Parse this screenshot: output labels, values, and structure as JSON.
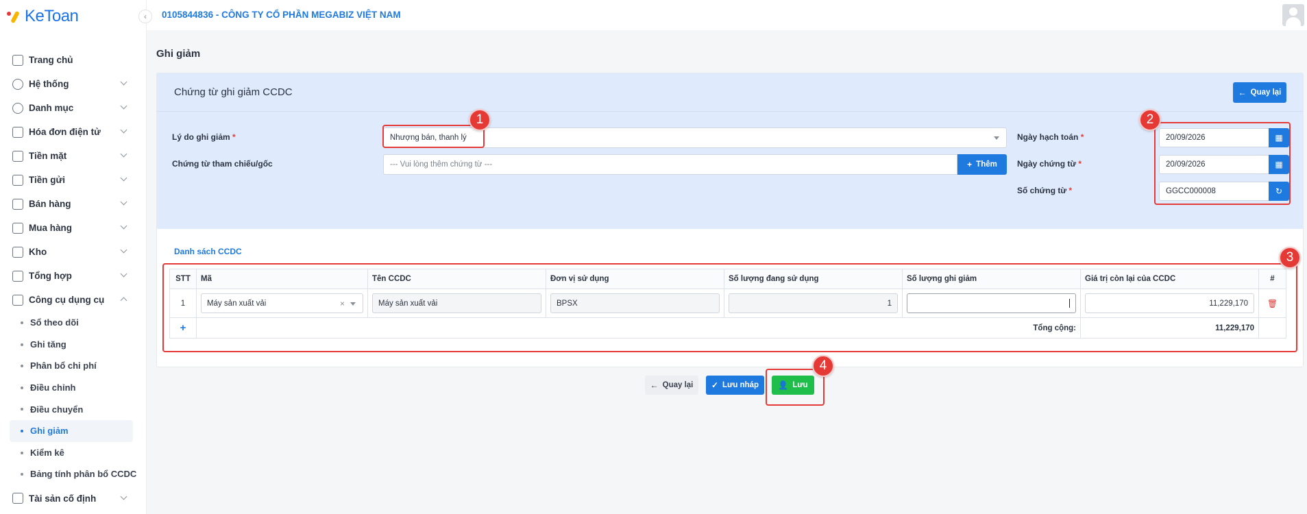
{
  "app": {
    "logo_text": "KeToan",
    "collapse_glyph": "‹"
  },
  "topbar": {
    "company": "0105844836 - CÔNG TY CỔ PHẦN MEGABIZ VIỆT NAM"
  },
  "sidebar": {
    "items": [
      {
        "label": "Trang chủ",
        "icon": "home-icon"
      },
      {
        "label": "Hệ thống",
        "icon": "gear-icon"
      },
      {
        "label": "Danh mục",
        "icon": "grid-icon"
      },
      {
        "label": "Hóa đơn điện tử",
        "icon": "invoice-icon"
      },
      {
        "label": "Tiền mặt",
        "icon": "cash-icon"
      },
      {
        "label": "Tiền gửi",
        "icon": "bank-icon"
      },
      {
        "label": "Bán hàng",
        "icon": "sales-icon"
      },
      {
        "label": "Mua hàng",
        "icon": "purchase-icon"
      },
      {
        "label": "Kho",
        "icon": "warehouse-icon"
      },
      {
        "label": "Tổng hợp",
        "icon": "chart-icon"
      },
      {
        "label": "Công cụ dụng cụ",
        "icon": "tools-icon"
      },
      {
        "label": "Tài sản cố định",
        "icon": "car-icon"
      }
    ],
    "sub_items": [
      "Sổ theo dõi",
      "Ghi tăng",
      "Phân bổ chi phí",
      "Điều chỉnh",
      "Điều chuyển",
      "Ghi giảm",
      "Kiểm kê",
      "Bảng tính phân bổ CCDC"
    ]
  },
  "page": {
    "title": "Ghi giảm"
  },
  "form": {
    "title": "Chứng từ ghi giảm CCDC",
    "back_button": "Quay lại",
    "reason_label": "Lý do ghi giảm",
    "reason_value": "Nhượng bán, thanh lý",
    "reference_label": "Chứng từ tham chiếu/gốc",
    "reference_placeholder": "--- Vui lòng thêm chứng từ ---",
    "add_button": "Thêm",
    "posting_date_label": "Ngày hạch toán",
    "posting_date_value": "20/09/2026",
    "voucher_date_label": "Ngày chứng từ",
    "voucher_date_value": "20/09/2026",
    "voucher_no_label": "Số chứng từ",
    "voucher_no_value": "GGCC000008",
    "required_mark": "*"
  },
  "list": {
    "title": "Danh sách CCDC",
    "columns": [
      "STT",
      "Mã",
      "Tên CCDC",
      "Đơn vị sử dụng",
      "Số lượng đang sử dụng",
      "Số lượng ghi giảm",
      "Giá trị còn lại của CCDC",
      "#"
    ],
    "rows": [
      {
        "stt": "1",
        "code": "Máy sản xuất vải",
        "name": "Máy sản xuất vải",
        "unit": "BPSX",
        "qty_in_use": "1",
        "qty_reduce": "",
        "remaining_value": "11,229,170"
      }
    ],
    "add_row": "+",
    "total_label": "Tổng cộng:",
    "total_value": "11,229,170"
  },
  "actions": {
    "back": "Quay lại",
    "save_draft": "Lưu nháp",
    "save": "Lưu"
  },
  "annotations": [
    "1",
    "2",
    "3",
    "4"
  ],
  "colors": {
    "accent": "#1f7ae0",
    "success": "#1fbe4a",
    "highlight": "#e53935",
    "header_bg": "#dfeafc"
  }
}
